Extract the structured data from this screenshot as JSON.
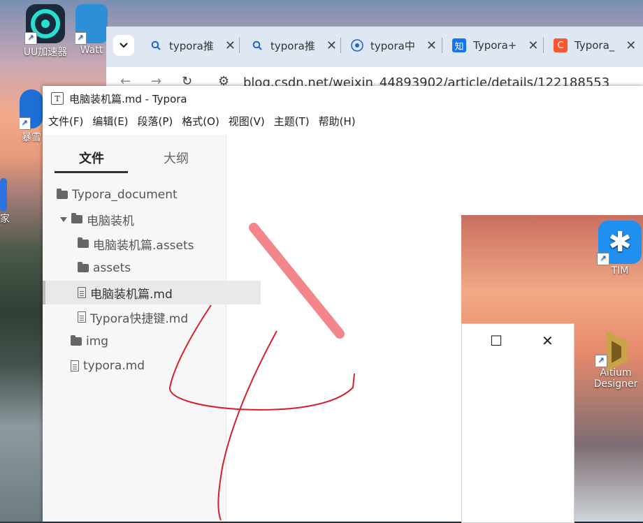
{
  "desktop": {
    "icons": [
      {
        "label": "UU加速器",
        "icon": "uu-accelerator-icon"
      },
      {
        "label": "Watt",
        "icon": "watt-toolkit-icon"
      },
      {
        "label": "暴雪",
        "icon": "battlenet-icon"
      },
      {
        "label": "家",
        "icon": "app-icon"
      },
      {
        "label": "TIM",
        "icon": "tim-icon"
      },
      {
        "label": "Altium",
        "icon": "altium-icon"
      },
      {
        "label": "Designer",
        "icon": ""
      }
    ]
  },
  "browser": {
    "tabs": [
      {
        "label": "typora推",
        "icon": "search-icon"
      },
      {
        "label": "typora推",
        "icon": "search-icon"
      },
      {
        "label": "typora中",
        "icon": "rss-icon"
      },
      {
        "label": "Typora+",
        "icon": "zhihu-icon",
        "badge": "知"
      },
      {
        "label": "Typora_",
        "icon": "csdn-icon",
        "badge": "C"
      }
    ],
    "url": "blog.csdn.net/weixin_44893902/article/details/122188553"
  },
  "typora": {
    "title": "电脑装机篇.md - Typora",
    "app_icon": "T",
    "menu": [
      "文件(F)",
      "编辑(E)",
      "段落(P)",
      "格式(O)",
      "视图(V)",
      "主题(T)",
      "帮助(H)"
    ],
    "sidebar_tabs": [
      "文件",
      "大纲"
    ],
    "tree": [
      {
        "label": "Typora_document",
        "type": "folder"
      },
      {
        "label": "电脑装机",
        "type": "folder-open"
      },
      {
        "label": "电脑装机篇.assets",
        "type": "folder"
      },
      {
        "label": "assets",
        "type": "folder"
      },
      {
        "label": "电脑装机篇.md",
        "type": "file",
        "selected": true
      },
      {
        "label": "Typora快捷键.md",
        "type": "file"
      },
      {
        "label": "img",
        "type": "folder"
      },
      {
        "label": "typora.md",
        "type": "file"
      }
    ]
  },
  "dialog": {
    "maximize": "☐",
    "close": "✕"
  },
  "colors": {
    "red_annotation": "#d81e2c",
    "pink_stroke": "#f2868a"
  }
}
